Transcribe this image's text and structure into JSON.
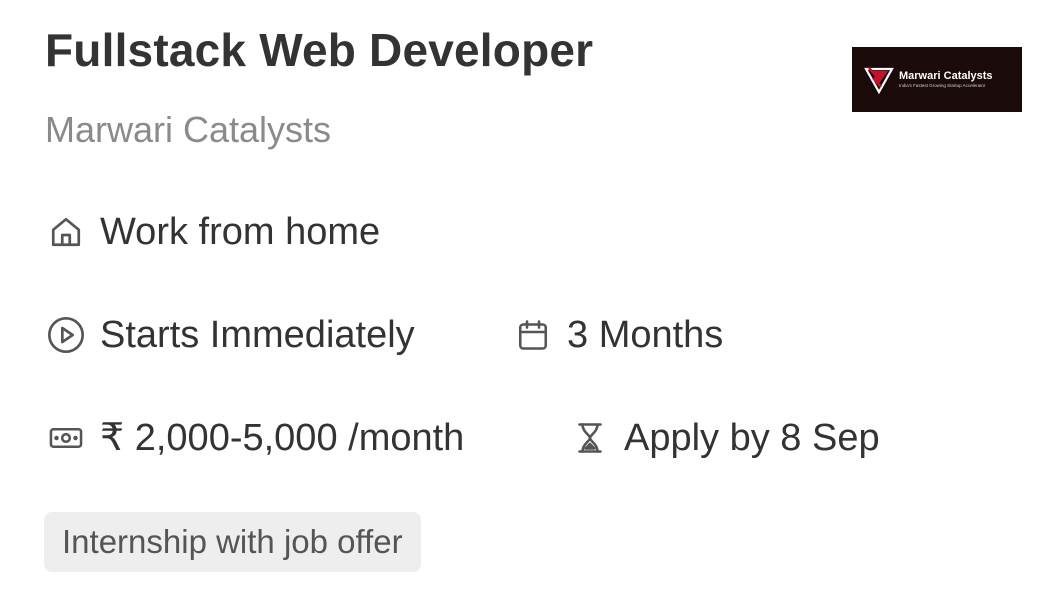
{
  "job": {
    "title": "Fullstack Web Developer",
    "company": "Marwari Catalysts"
  },
  "logo": {
    "name": "Marwari Catalysts",
    "tagline": "India's Fastest Growing Startup Accelerator",
    "background_color": "#1a0a0a",
    "accent_color": "#c8102e"
  },
  "details": {
    "location": {
      "icon": "home-icon",
      "text": "Work from home"
    },
    "start": {
      "icon": "play-circle-icon",
      "text": "Starts Immediately"
    },
    "duration": {
      "icon": "calendar-icon",
      "text": "3 Months"
    },
    "stipend": {
      "icon": "money-icon",
      "text": "₹ 2,000-5,000 /month"
    },
    "deadline": {
      "icon": "hourglass-icon",
      "text": "Apply by 8 Sep"
    }
  },
  "tags": [
    {
      "label": "Internship with job offer"
    }
  ]
}
